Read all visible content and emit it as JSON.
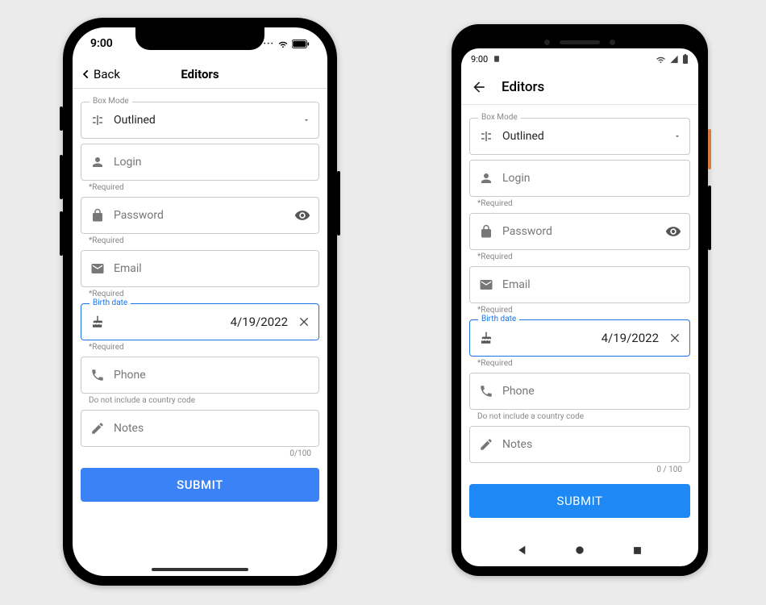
{
  "ios": {
    "time": "9:00",
    "back_label": "Back",
    "title": "Editors"
  },
  "android": {
    "time": "9:00",
    "title": "Editors"
  },
  "form": {
    "box_mode": {
      "label": "Box Mode",
      "value": "Outlined"
    },
    "login": {
      "placeholder": "Login",
      "helper": "*Required"
    },
    "password": {
      "placeholder": "Password",
      "helper": "*Required"
    },
    "email": {
      "placeholder": "Email",
      "helper": "*Required"
    },
    "birth": {
      "label": "Birth date",
      "value": "4/19/2022",
      "helper": "*Required"
    },
    "phone": {
      "placeholder": "Phone",
      "helper": "Do not include a country code"
    },
    "notes": {
      "placeholder": "Notes",
      "counter_ios": "0/100",
      "counter_android": "0 / 100"
    },
    "submit": "SUBMIT"
  }
}
